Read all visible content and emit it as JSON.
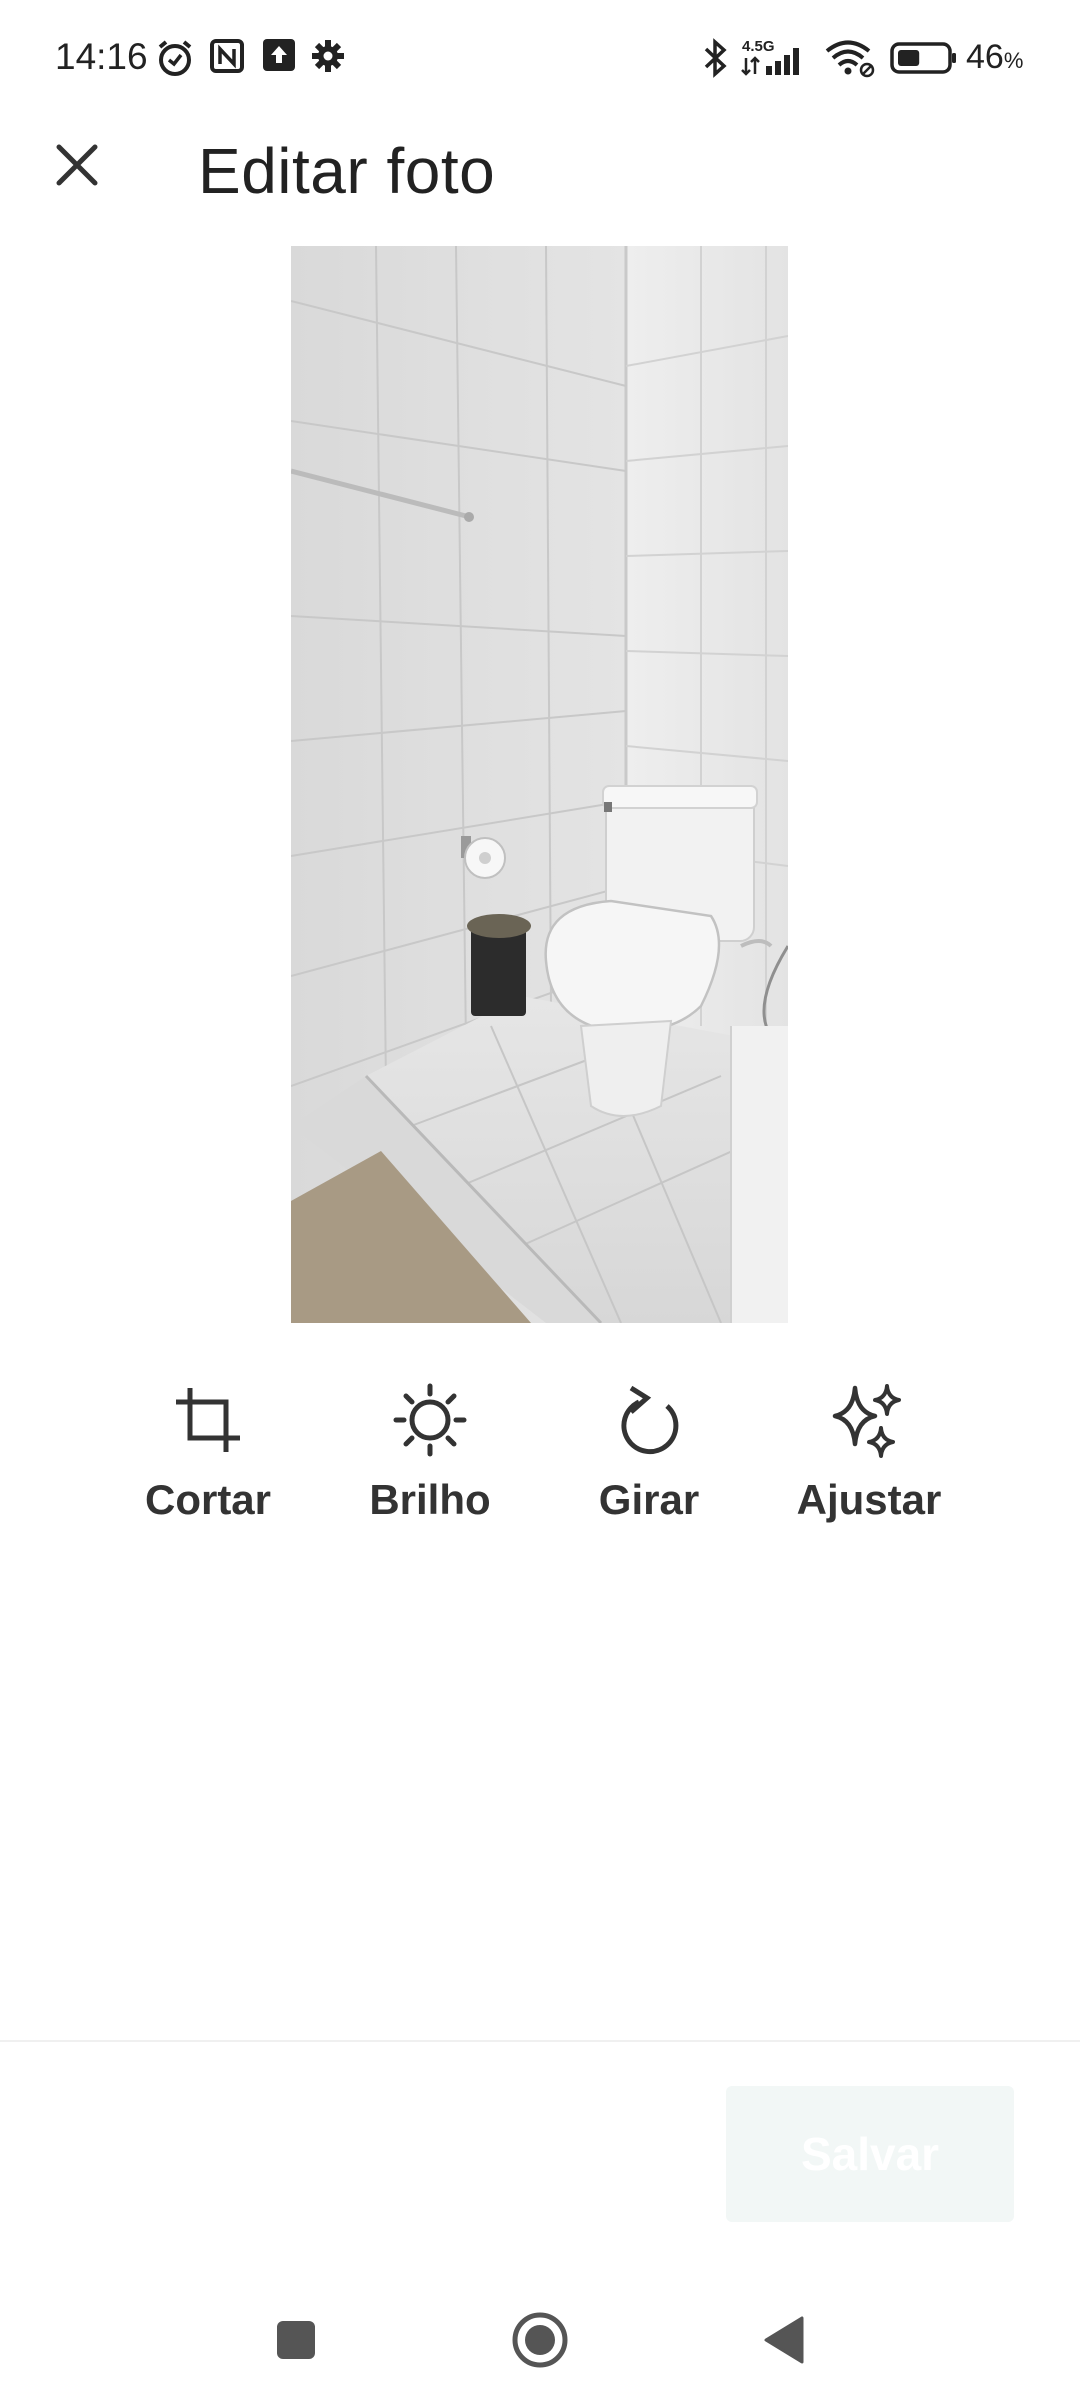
{
  "status_bar": {
    "time": "14:16",
    "network_label": "4.5G",
    "battery_percent": "46",
    "battery_unit": "%",
    "battery_level": 0.46,
    "icons": [
      "alarm-icon",
      "nfc-icon",
      "upload-icon",
      "settings-icon",
      "bluetooth-icon",
      "signal-icon",
      "wifi-icon",
      "battery-icon"
    ]
  },
  "header": {
    "title": "Editar foto",
    "close_icon": "close-icon"
  },
  "tools": [
    {
      "label": "Cortar",
      "icon": "crop-icon"
    },
    {
      "label": "Brilho",
      "icon": "brightness-icon"
    },
    {
      "label": "Girar",
      "icon": "rotate-icon"
    },
    {
      "label": "Ajustar",
      "icon": "sparkle-icon"
    }
  ],
  "footer": {
    "save_label": "Salvar"
  },
  "nav": {
    "icons": [
      "recents-icon",
      "home-icon",
      "back-icon"
    ]
  },
  "colors": {
    "text": "#222222",
    "save_bg": "#f2f7f6",
    "save_text": "#ffffff"
  }
}
